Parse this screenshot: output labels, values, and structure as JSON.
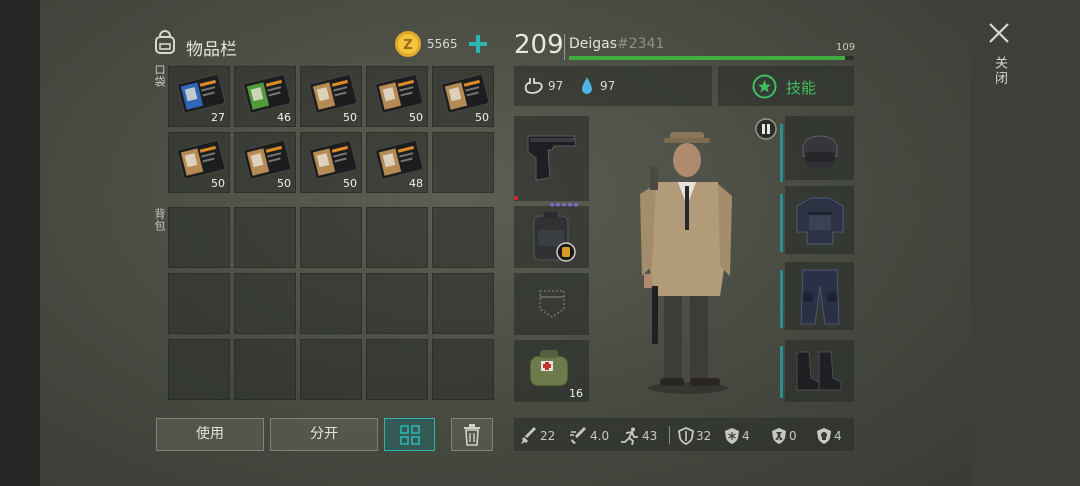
{
  "inventory": {
    "title": "物品栏",
    "coins": "5565",
    "pocket_label": "口袋",
    "backpack_label": "背包",
    "pocket_items": [
      {
        "count": "27",
        "color": "#2f66b8"
      },
      {
        "count": "46",
        "color": "#4f9a3a"
      },
      {
        "count": "50",
        "color": "#b58a55"
      },
      {
        "count": "50",
        "color": "#b58a55"
      },
      {
        "count": "50",
        "color": "#b58a55"
      },
      {
        "count": "50",
        "color": "#b58a55"
      },
      {
        "count": "50",
        "color": "#b58a55"
      },
      {
        "count": "50",
        "color": "#b58a55"
      },
      {
        "count": "48",
        "color": "#b58a55"
      }
    ]
  },
  "buttons": {
    "use": "使用",
    "split": "分开"
  },
  "player": {
    "level": "209",
    "name": "Deigas",
    "tag": "#2341",
    "xp_value": "109",
    "xp_fraction": 0.97,
    "hunger": "97",
    "thirst": "97",
    "skills_label": "技能"
  },
  "equipment": {
    "medkit_count": "16"
  },
  "stats": {
    "attack": "22",
    "attack_speed": "4.0",
    "speed": "43",
    "defense": "32",
    "cold": "4",
    "radiation": "0",
    "toxic": "4"
  },
  "close_label": "关闭",
  "colors": {
    "accent_teal": "#2a8f90",
    "xp_green": "#3fae3f",
    "skill_green": "#3fbf5f"
  }
}
